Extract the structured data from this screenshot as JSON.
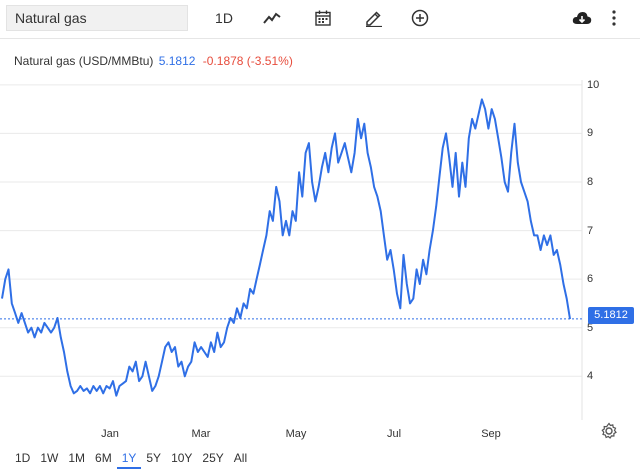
{
  "toolbar": {
    "symbol": "Natural gas",
    "interval": "1D",
    "icons": [
      "line-chart-icon",
      "calendar-icon",
      "pencil-icon",
      "add-compare-icon",
      "download-icon",
      "more-icon"
    ]
  },
  "legend": {
    "name": "Natural gas (USD/MMBtu)",
    "last": "5.1812",
    "change": "-0.1878 (-3.51%)"
  },
  "price_label": "5.1812",
  "ranges": [
    "1D",
    "1W",
    "1M",
    "6M",
    "1Y",
    "5Y",
    "10Y",
    "25Y",
    "All"
  ],
  "active_range": "1Y",
  "colors": {
    "line": "#2f6fe6",
    "negative": "#e74c3c",
    "grid": "#eaeaea"
  },
  "chart_data": {
    "type": "line",
    "title": "",
    "xlabel": "",
    "ylabel": "",
    "ylim": [
      3.1,
      10.1
    ],
    "x_tick_labels": [
      "Jan",
      "Mar",
      "May",
      "Jul",
      "Sep"
    ],
    "y_tick_labels": [
      "4",
      "5",
      "6",
      "7",
      "8",
      "9",
      "10"
    ],
    "y_ticks": [
      4,
      5,
      6,
      7,
      8,
      9,
      10
    ],
    "last_value": 5.1812,
    "series": [
      {
        "values": [
          5.6,
          6.0,
          6.2,
          5.5,
          5.3,
          5.1,
          5.3,
          5.1,
          4.9,
          5.0,
          4.8,
          5.0,
          4.9,
          5.1,
          5.0,
          4.9,
          5.0,
          5.2,
          4.8,
          4.5,
          4.1,
          3.8,
          3.65,
          3.7,
          3.8,
          3.7,
          3.75,
          3.65,
          3.8,
          3.7,
          3.8,
          3.65,
          3.8,
          3.75,
          3.9,
          3.6,
          3.8,
          3.85,
          3.9,
          4.2,
          4.1,
          4.3,
          3.9,
          4.0,
          4.3,
          4.0,
          3.7,
          3.8,
          4.0,
          4.3,
          4.6,
          4.7,
          4.5,
          4.6,
          4.2,
          4.3,
          4.0,
          4.2,
          4.3,
          4.7,
          4.5,
          4.6,
          4.5,
          4.4,
          4.7,
          4.5,
          4.9,
          4.6,
          4.7,
          5.0,
          5.2,
          5.1,
          5.4,
          5.2,
          5.5,
          5.4,
          5.8,
          5.7,
          6.0,
          6.3,
          6.6,
          6.9,
          7.4,
          7.2,
          7.9,
          7.6,
          6.9,
          7.2,
          6.9,
          7.4,
          7.2,
          8.2,
          7.7,
          8.6,
          8.8,
          8.0,
          7.6,
          7.9,
          8.3,
          8.6,
          8.2,
          8.7,
          9.0,
          8.4,
          8.6,
          8.8,
          8.5,
          8.2,
          8.6,
          9.3,
          8.9,
          9.2,
          8.6,
          8.3,
          7.9,
          7.7,
          7.4,
          6.9,
          6.4,
          6.6,
          6.2,
          5.7,
          5.4,
          6.5,
          5.9,
          5.5,
          5.6,
          6.2,
          5.9,
          6.4,
          6.1,
          6.6,
          7.0,
          7.5,
          8.1,
          8.7,
          9.0,
          8.5,
          7.9,
          8.6,
          7.7,
          8.4,
          7.9,
          8.9,
          9.3,
          9.1,
          9.4,
          9.7,
          9.5,
          9.1,
          9.5,
          9.3,
          8.9,
          8.5,
          8.0,
          7.8,
          8.6,
          9.2,
          8.4,
          8.0,
          7.8,
          7.6,
          7.2,
          6.9,
          6.9,
          6.6,
          6.9,
          6.7,
          6.9,
          6.5,
          6.6,
          6.3,
          5.9,
          5.6,
          5.18
        ]
      }
    ]
  }
}
